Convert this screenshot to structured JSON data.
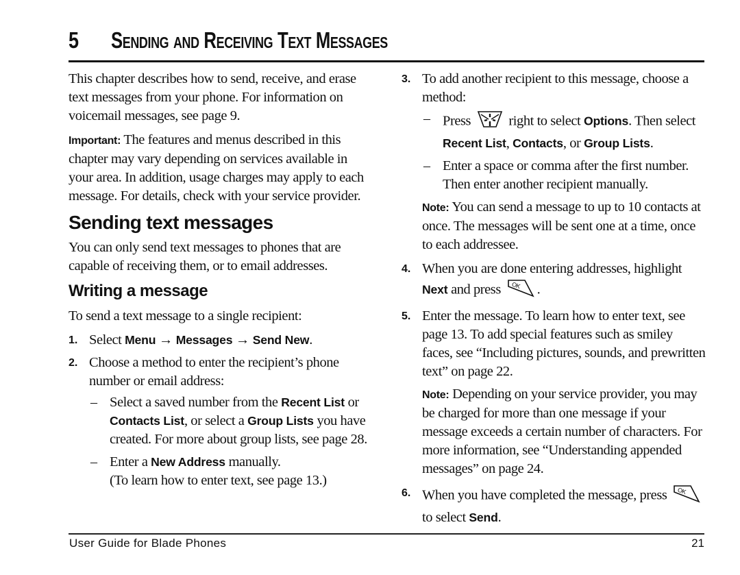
{
  "chapter": {
    "number": "5",
    "title": "Sending and Receiving Text Messages"
  },
  "intro": {
    "text": "This chapter describes how to send, receive, and erase text messages from your phone. For information on voicemail messages, see page 9."
  },
  "important": {
    "label": "Important:",
    "text": "The features and menus described in this chapter may vary depending on services available in your area. In addition, usage charges may apply to each message. For details, check with your service provider."
  },
  "section": {
    "title": "Sending text messages",
    "text": "You can only send text messages to phones that are capable of receiving them, or to email addresses."
  },
  "subsection": {
    "title": "Writing a message",
    "lead": "To send a text message to a single recipient:"
  },
  "steps": {
    "s1": {
      "num": "1.",
      "pre": "Select",
      "menu": "Menu",
      "arrow1": "→",
      "messages": "Messages",
      "arrow2": "→",
      "send_new": "Send New",
      "end": "."
    },
    "s2": {
      "num": "2.",
      "text": "Choose a method to enter the recipient’s phone number or email address:",
      "opt1": {
        "dash": "–",
        "t1": "Select a saved number from the",
        "recent_list": "Recent List",
        "t2": "or",
        "contacts_list": "Contacts List",
        "t3": ", or select a",
        "group_lists": "Group Lists",
        "t4": "you have created. For more about group lists, see page 28."
      },
      "opt2": {
        "dash": "–",
        "t1": "Enter a",
        "new_address": "New Address",
        "t2": "manually.",
        "t3": "(To learn how to enter text, see page 13.)"
      }
    },
    "s3": {
      "num": "3.",
      "text": "To add another recipient to this message, choose a method:",
      "opt1": {
        "dash": "–",
        "t1": "Press",
        "icon": "navigation-key-icon",
        "t2": "right to select",
        "options": "Options",
        "t3": ". Then select",
        "recent_list": "Recent List",
        "sep1": ",",
        "contacts": "Contacts",
        "t4": ", or",
        "group_lists": "Group Lists",
        "end": "."
      },
      "opt2": {
        "dash": "–",
        "text": "Enter a space or comma after the first number. Then enter another recipient manually."
      },
      "note": {
        "label": "Note:",
        "text": "You can send a message to up to 10 contacts at once. The messages will be sent one at a time, once to each addressee."
      }
    },
    "s4": {
      "num": "4.",
      "t1": "When you are done entering addresses, highlight",
      "next": "Next",
      "t2": "and press",
      "icon": "ok-key-icon",
      "end": "."
    },
    "s5": {
      "num": "5.",
      "text": "Enter the message. To learn how to enter text, see page 13. To add special features such as smiley faces, see “Including pictures, sounds, and prewritten text” on page 22.",
      "note": {
        "label": "Note:",
        "text": "Depending on your service provider, you may be charged for more than one message if your message exceeds a certain number of characters. For more information, see “Understanding appended messages” on page 24."
      }
    },
    "s6": {
      "num": "6.",
      "t1": "When you have completed the message, press",
      "icon": "ok-key-icon",
      "t2": "to select",
      "send": "Send",
      "end": "."
    }
  },
  "footer": {
    "left": "User Guide for Blade Phones",
    "page": "21"
  }
}
